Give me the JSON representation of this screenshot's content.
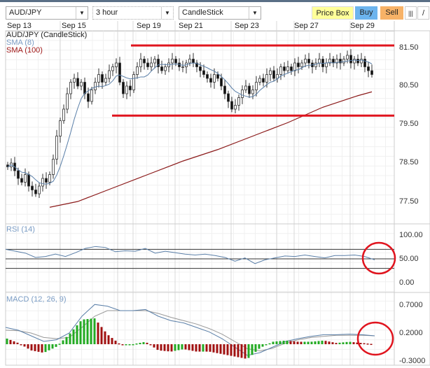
{
  "toolbar": {
    "symbol": "AUD/JPY",
    "interval": "3 hour",
    "chart_type": "CandleStick",
    "price_box": "Price Box",
    "buy": "Buy",
    "sell": "Sell",
    "icons": [
      "bars-icon",
      "draw-line-icon"
    ]
  },
  "dates": [
    "Sep 13",
    "Sep 15",
    "Sep 19",
    "Sep 21",
    "Sep 23",
    "Sep 27",
    "Sep 29"
  ],
  "colors": {
    "up": "#ffffff",
    "down": "#111111",
    "sma8": "#5a7fa8",
    "sma100": "#8b1a1a",
    "annotation": "#e0141e",
    "hist_up": "#22aa22",
    "hist_down": "#a01010"
  },
  "chart_data": [
    {
      "type": "candlestick",
      "title": "AUD/JPY (CandleStick)",
      "legend": [
        "SMA (8)",
        "SMA (100)"
      ],
      "yticks": [
        "81.50",
        "80.50",
        "79.50",
        "78.50",
        "77.50"
      ],
      "ylim": [
        77.2,
        81.8
      ],
      "closes": [
        78.4,
        78.5,
        78.3,
        78.1,
        78.0,
        78.2,
        77.9,
        77.8,
        77.7,
        77.9,
        78.1,
        78.0,
        78.2,
        78.6,
        79.2,
        79.6,
        79.9,
        80.3,
        80.6,
        80.7,
        80.5,
        80.6,
        80.3,
        80.1,
        80.4,
        80.6,
        80.8,
        80.6,
        80.7,
        80.9,
        81.0,
        81.1,
        80.6,
        80.3,
        80.5,
        80.4,
        80.8,
        81.0,
        81.2,
        81.1,
        81.0,
        81.1,
        81.2,
        81.0,
        80.9,
        81.0,
        81.1,
        81.2,
        81.1,
        81.0,
        81.0,
        81.1,
        81.2,
        81.1,
        81.0,
        80.9,
        80.8,
        80.7,
        80.6,
        80.8,
        80.7,
        80.5,
        80.3,
        80.1,
        79.9,
        80.0,
        80.2,
        80.4,
        80.5,
        80.3,
        80.4,
        80.6,
        80.7,
        80.6,
        80.8,
        80.9,
        80.7,
        80.8,
        81.0,
        80.9,
        81.0,
        80.9,
        81.1,
        81.0,
        81.1,
        81.2,
        81.1,
        81.0,
        81.1,
        81.2,
        81.0,
        81.1,
        81.2,
        81.1,
        81.2,
        81.1,
        81.2,
        81.3,
        81.1,
        81.2,
        81.1,
        81.2,
        81.0,
        80.9,
        80.8
      ],
      "sma100": [
        [
          12,
          77.35
        ],
        [
          20,
          77.5
        ],
        [
          30,
          77.85
        ],
        [
          40,
          78.2
        ],
        [
          50,
          78.55
        ],
        [
          60,
          78.85
        ],
        [
          70,
          79.2
        ],
        [
          80,
          79.55
        ],
        [
          90,
          79.95
        ],
        [
          100,
          80.25
        ],
        [
          104,
          80.35
        ]
      ],
      "support_resistance": [
        81.5,
        79.75
      ]
    },
    {
      "type": "line",
      "title": "RSI (14)",
      "yticks": [
        "100.00",
        "50.00",
        "0.00"
      ],
      "levels": [
        70,
        50,
        30
      ],
      "values": [
        70,
        66,
        62,
        53,
        55,
        60,
        55,
        63,
        72,
        76,
        74,
        65,
        67,
        66,
        72,
        62,
        66,
        63,
        60,
        58,
        60,
        57,
        53,
        45,
        52,
        40,
        48,
        52,
        56,
        55,
        58,
        55,
        52,
        57,
        57,
        58,
        55,
        48
      ]
    },
    {
      "type": "line",
      "title": "MACD (12, 26, 9)",
      "yticks": [
        "0.7000",
        "0.2000",
        "-0.3000"
      ],
      "macd": [
        0.3,
        0.25,
        0.15,
        0.05,
        0.08,
        0.2,
        0.5,
        0.71,
        0.68,
        0.6,
        0.6,
        0.62,
        0.5,
        0.42,
        0.38,
        0.3,
        0.22,
        0.1,
        -0.05,
        -0.2,
        -0.15,
        -0.05,
        0.05,
        0.1,
        0.14,
        0.17,
        0.17,
        0.18,
        0.17,
        0.15
      ],
      "signal": [
        0.25,
        0.24,
        0.2,
        0.12,
        0.1,
        0.12,
        0.3,
        0.5,
        0.6,
        0.6,
        0.6,
        0.6,
        0.55,
        0.48,
        0.42,
        0.36,
        0.28,
        0.18,
        0.05,
        -0.08,
        -0.12,
        -0.07,
        0.02,
        0.08,
        0.12,
        0.14,
        0.16,
        0.16,
        0.16,
        0.15
      ]
    }
  ]
}
